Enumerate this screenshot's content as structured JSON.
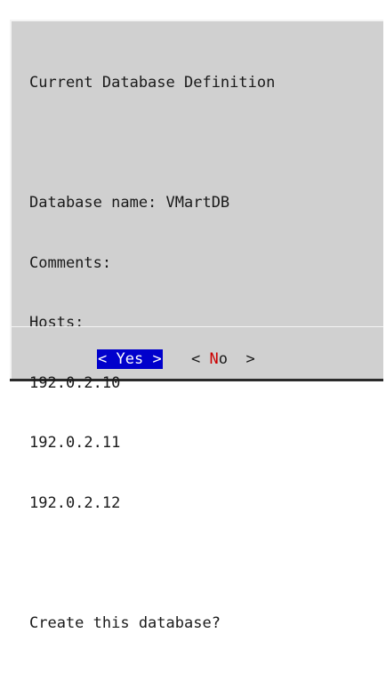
{
  "dialog": {
    "title": "Current Database Definition",
    "database_name_line": "Database name: VMartDB",
    "comments_line": "Comments:",
    "hosts_label": "Hosts:",
    "hosts": [
      "192.0.2.10",
      "192.0.2.11",
      "192.0.2.12"
    ],
    "question": "Create this database?"
  },
  "buttons": {
    "yes": {
      "open": "< ",
      "hotkey": "Y",
      "rest": "es",
      "close": " >"
    },
    "no": {
      "open": "< ",
      "hotkey": "N",
      "rest": "o",
      "close": "  >"
    }
  },
  "colors": {
    "dialog_background": "#d0d0d0",
    "selected_button_background": "#0000cc",
    "hotkey_red": "#cc0000"
  }
}
